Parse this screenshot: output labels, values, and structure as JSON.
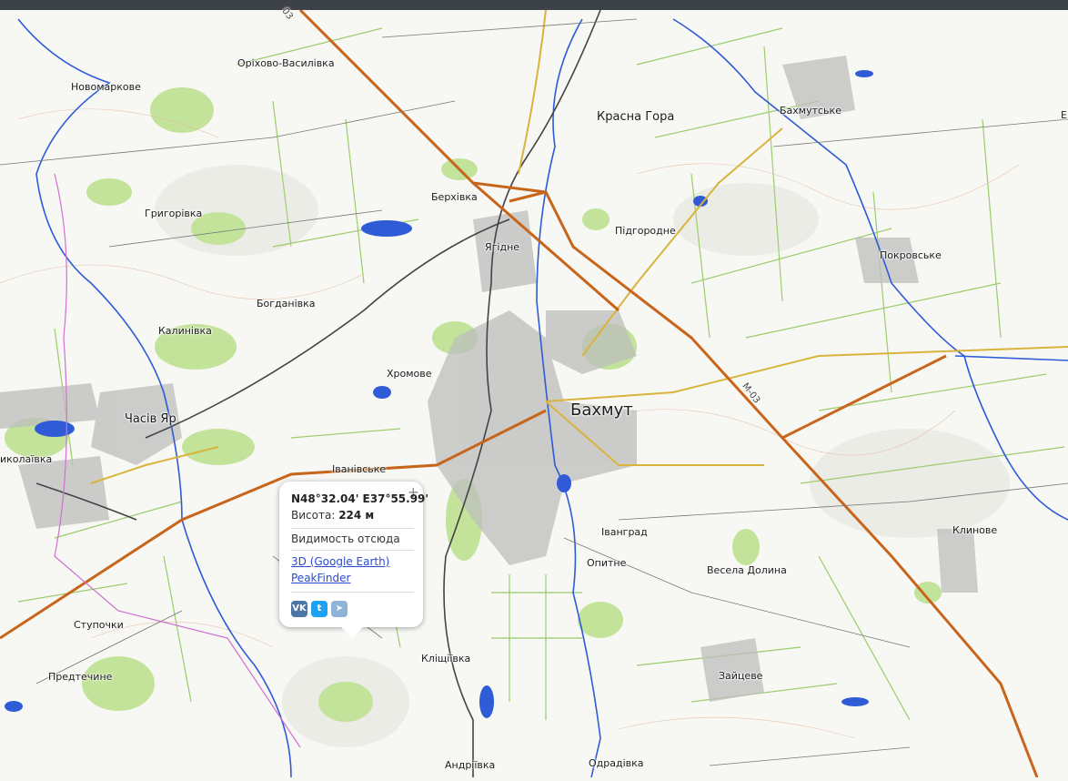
{
  "map": {
    "labels": {
      "orikhovo_vasylivka": "Оріхово-Василівка",
      "novomarkove": "Новомаркове",
      "krasna_hora": "Красна Гора",
      "bakhmutske": "Бахмутське",
      "berkhivka": "Берхівка",
      "hryhorivka": "Григорівка",
      "yahidne": "Ягідне",
      "pidhorodne": "Підгородне",
      "pokrovske": "Покровське",
      "bohdanivka": "Богданівка",
      "kalynivka": "Калинівка",
      "khromove": "Хромове",
      "chasiv_yar": "Часів Яр",
      "bakhmut": "Бахмут",
      "ivanivske": "Іванівське",
      "mykolaivka": "иколаївка",
      "ivanhrad": "Іванград",
      "opytne": "Опитне",
      "vesela_dolyna": "Весела Долина",
      "klynove": "Клинове",
      "stupochky": "Ступочки",
      "predtechyne": "Предтечине",
      "klishchiivka": "Кліщіївка",
      "zaitseve": "Зайцеве",
      "andriivka": "Андріївка",
      "odradivka": "Одрадівка",
      "road_m03": "М-03",
      "road_03": "03",
      "edge_e": "Е"
    }
  },
  "popup": {
    "coords": "N48°32.04' E37°55.99'",
    "altitude_label": "Висота:",
    "altitude_value": "224 м",
    "visibility": "Видимость отсюда",
    "google_earth": "3D (Google Earth)",
    "peakfinder": "PeakFinder",
    "close_icon": "+",
    "share": {
      "vk": "VK",
      "twitter": "t",
      "telegram": "➤"
    }
  },
  "colors": {
    "topbar": "#3c4248",
    "motorway": "#c8651a",
    "road_yellow": "#d9b43c",
    "water": "#2f5bd6",
    "forest": "#c3e39a",
    "field_lines": "#9ccc6c",
    "urban": "#9a9a9a"
  }
}
